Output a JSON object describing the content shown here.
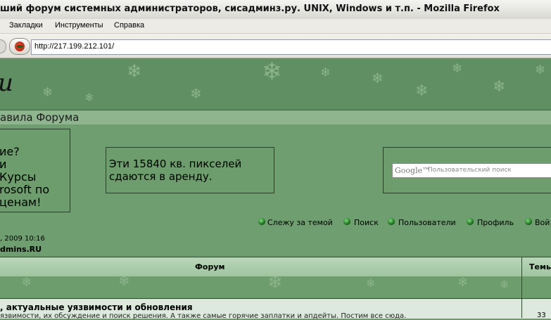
{
  "window": {
    "title": "ший форум системных администраторов, сисадминз.ру. UNIX, Windows и т.п. - Mozilla Firefox"
  },
  "menu": {
    "items": [
      "Закладки",
      "Инструменты",
      "Справка"
    ]
  },
  "navbar": {
    "url": "http://217.199.212.101/"
  },
  "header": {
    "logo_fragment": "u"
  },
  "rules_bar": {
    "label": "авила Форума"
  },
  "ads": {
    "left_lines": [
      "ие?",
      "и",
      " Курсы",
      "rosoft по",
      "ценам!"
    ],
    "middle_lines": [
      "Эти 15840 кв. пикселей",
      "сдаются в аренду."
    ]
  },
  "search": {
    "logo": "Google™",
    "placeholder": "Пользовательский поиск"
  },
  "nav_links": [
    "Слежу за темой",
    "Поиск",
    "Пользователи",
    "Профиль",
    "Вой"
  ],
  "info": {
    "date": ", 2009 10:16",
    "site": "dmins.RU"
  },
  "table": {
    "headers": {
      "forum": "Форум",
      "topics": "Темы"
    },
    "rows": [
      {
        "title": ", актуальные уязвимости и обновления",
        "desc": "язвимости, их обсуждение и поиск решения. А также самые горячие заплатки и апдейты. Постим все сюда.",
        "count": "33"
      }
    ]
  },
  "colors": {
    "page_bg": "#6d9d6d",
    "header_bg": "#5f8f62",
    "row_bg": "#dce9dc",
    "border": "#2e4a2e"
  }
}
